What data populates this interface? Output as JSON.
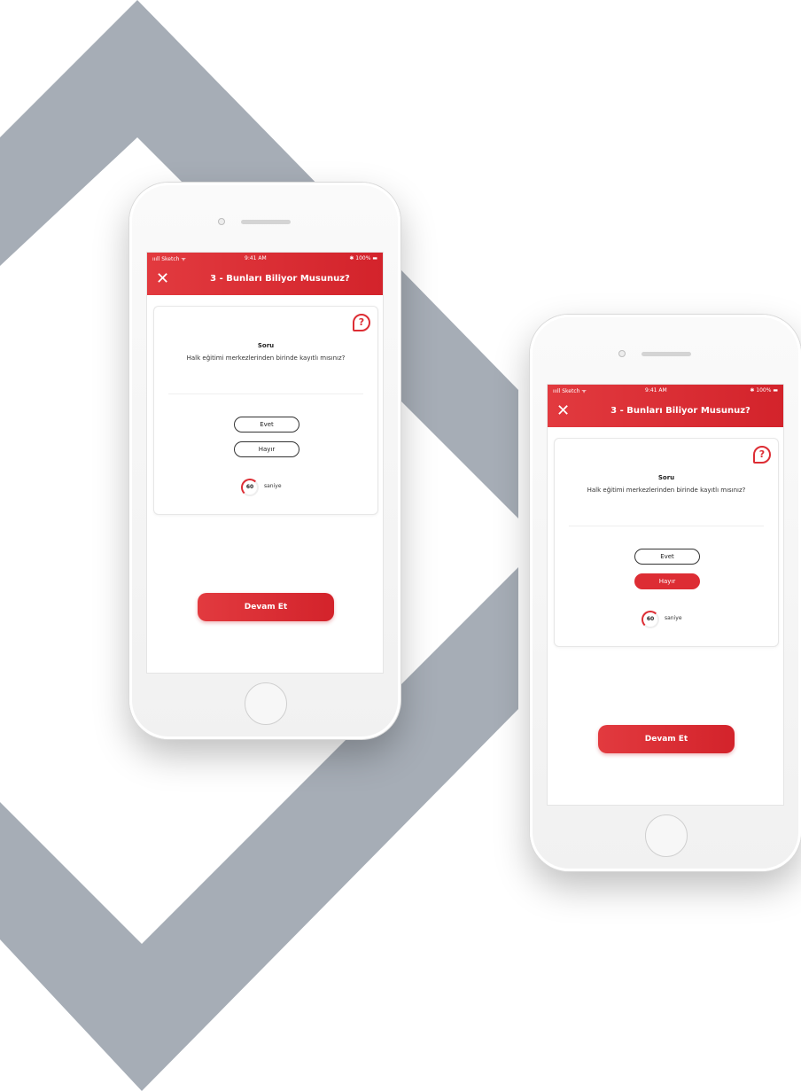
{
  "colors": {
    "accent": "#dd2d34",
    "background_shape": "#a6adb6"
  },
  "phones": [
    {
      "status": {
        "carrier": "ıııll Sketch ᯤ",
        "time": "9:41 AM",
        "battery": "✱ 100% ▬"
      },
      "header": {
        "close_icon": "close-icon",
        "title": "3 - Bunları Biliyor Musunuz?"
      },
      "card": {
        "help_icon": "?",
        "label": "Soru",
        "question": "Halk eğitimi merkezlerinden birinde kayıtlı mısınız?",
        "answers": [
          {
            "label": "Evet",
            "selected": false
          },
          {
            "label": "Hayır",
            "selected": false
          }
        ],
        "timer_value": "60",
        "timer_unit": "saniye"
      },
      "continue_label": "Devam Et"
    },
    {
      "status": {
        "carrier": "ıııll Sketch ᯤ",
        "time": "9:41 AM",
        "battery": "✱ 100% ▬"
      },
      "header": {
        "close_icon": "close-icon",
        "title": "3 - Bunları Biliyor Musunuz?"
      },
      "card": {
        "help_icon": "?",
        "label": "Soru",
        "question": "Halk eğitimi merkezlerinden birinde kayıtlı mısınız?",
        "answers": [
          {
            "label": "Evet",
            "selected": false
          },
          {
            "label": "Hayır",
            "selected": true
          }
        ],
        "timer_value": "60",
        "timer_unit": "saniye"
      },
      "continue_label": "Devam Et"
    }
  ]
}
